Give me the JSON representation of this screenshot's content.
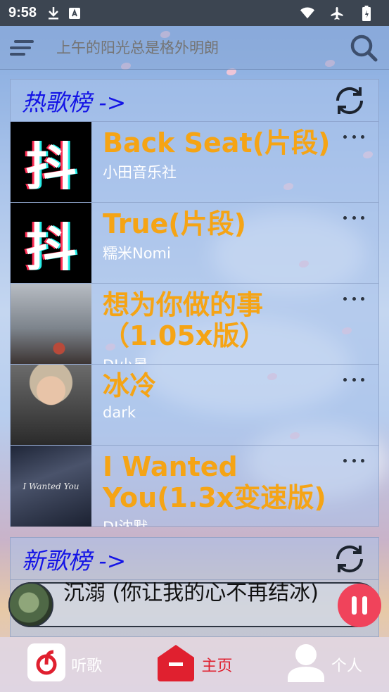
{
  "status_bar": {
    "time": "9:58",
    "icons_left": [
      "download-icon",
      "accessibility-icon"
    ],
    "icons_right": [
      "wifi-icon",
      "airplane-icon",
      "battery-icon"
    ]
  },
  "top_bar": {
    "menu_icon": "menu-icon",
    "search_placeholder": "上午的阳光总是格外明朗",
    "search_icon": "search-icon"
  },
  "hot_chart": {
    "title": "热歌榜 ->",
    "refresh_icon": "refresh-icon",
    "songs": [
      {
        "title": "Back Seat(片段)",
        "artist": "小田音乐社",
        "cover": "douyin-cover",
        "cover_text": "抖"
      },
      {
        "title": "True(片段)",
        "artist": "糯米Nomi",
        "cover": "douyin-cover",
        "cover_text": "抖"
      },
      {
        "title": "想为你做的事（1.05x版）",
        "artist": "DJ小暑",
        "cover": "rain-window-cover"
      },
      {
        "title": "冰冷",
        "artist": "dark",
        "cover": "portrait-cover"
      },
      {
        "title": "I Wanted You(1.3x变速版)",
        "artist": "DJ沈默",
        "cover": "wanted-you-cover",
        "cover_text": "I Wanted You"
      }
    ]
  },
  "new_chart": {
    "title": "新歌榜 ->",
    "refresh_icon": "refresh-icon"
  },
  "now_playing": {
    "title": "沉溺 (你让我的心不再结冰)",
    "state": "playing"
  },
  "bottom_nav": {
    "items": [
      {
        "label": "听歌",
        "icon": "netease-music-icon",
        "active": false
      },
      {
        "label": "主页",
        "icon": "home-icon",
        "active": true
      },
      {
        "label": "个人",
        "icon": "user-icon",
        "active": false
      }
    ]
  },
  "colors": {
    "accent": "#f5a415",
    "chart_title": "#1414e6",
    "active_nav": "#e0202f",
    "play_button": "#f0435b"
  }
}
